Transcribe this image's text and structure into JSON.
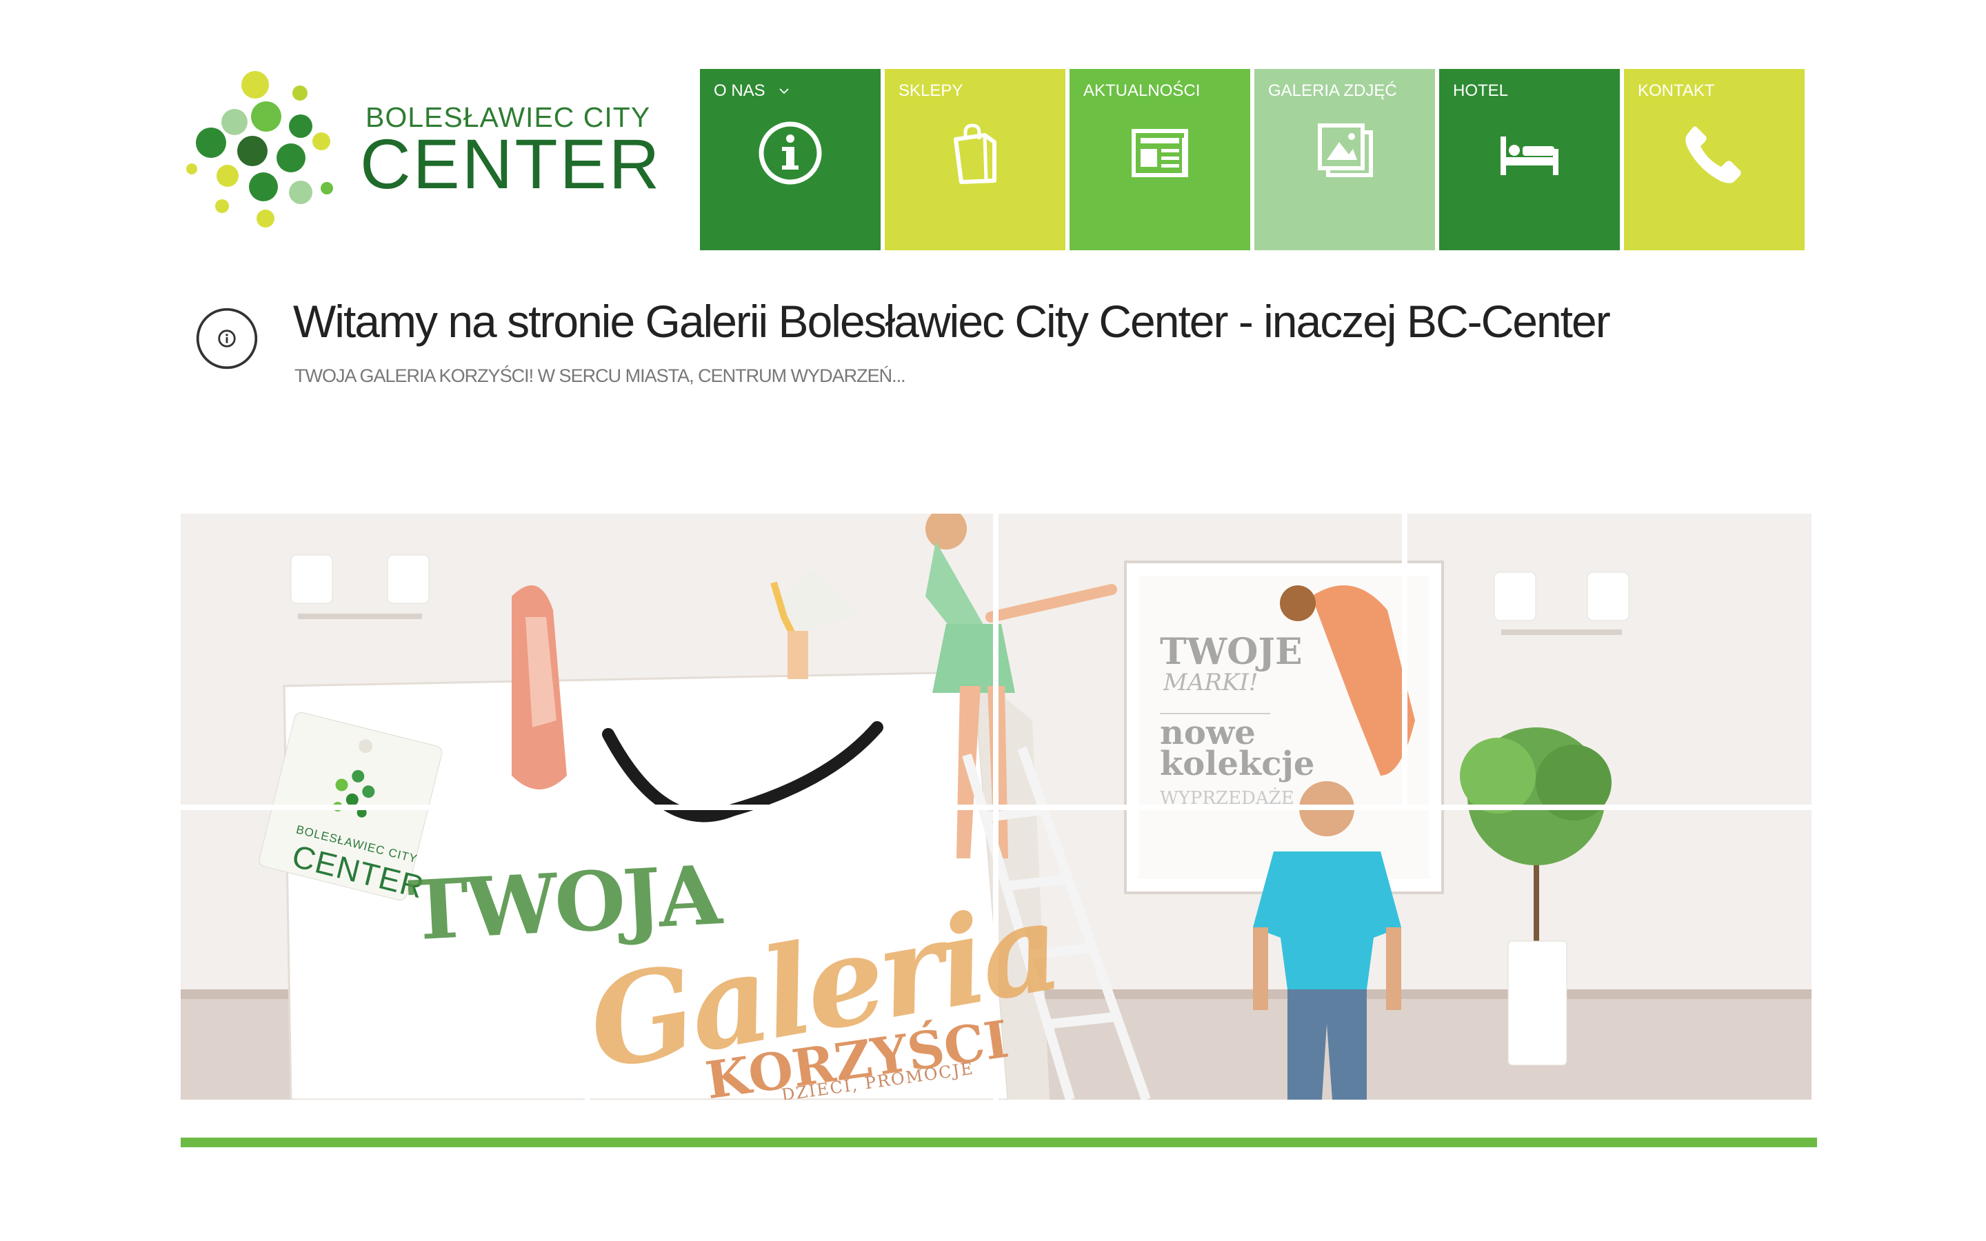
{
  "brand": {
    "line1": "BOLESŁAWIEC CITY",
    "line2": "CENTER"
  },
  "nav": {
    "items": [
      {
        "label": "O NAS",
        "icon": "info-icon",
        "color": "#2e8b33",
        "has_dropdown": true
      },
      {
        "label": "SKLEPY",
        "icon": "shopping-bag-icon",
        "color": "#d4dd3f"
      },
      {
        "label": "AKTUALNOŚCI",
        "icon": "newspaper-icon",
        "color": "#6cc043"
      },
      {
        "label": "GALERIA ZDJĘĆ",
        "icon": "gallery-icon",
        "color": "#a5d39c"
      },
      {
        "label": "HOTEL",
        "icon": "bed-icon",
        "color": "#2e8b33"
      },
      {
        "label": "KONTAKT",
        "icon": "phone-icon",
        "color": "#d4dd3f"
      }
    ]
  },
  "page": {
    "title": "Witamy na stronie Galerii Bolesławiec City Center - inaczej BC-Center",
    "subtitle": "TWOJA GALERIA KORZYŚCI! W SERCU MIASTA, CENTRUM WYDARZEŃ..."
  },
  "hero": {
    "word1": "TWOJA",
    "word2": "Galeria",
    "word3": "KORZYŚCI",
    "tagline": "DZIECI, PROMOCJE",
    "tag_small": "BOLESŁAWIEC CITY",
    "tag_big": "CENTER",
    "poster1": "TWOJE",
    "poster2": "MARKI!",
    "poster3": "nowe",
    "poster4": "kolekcje",
    "poster5": "WYPRZEDAŻE"
  },
  "colors": {
    "accent": "#6dbb45",
    "dark_green": "#2e8b33",
    "lime": "#d4dd3f"
  }
}
